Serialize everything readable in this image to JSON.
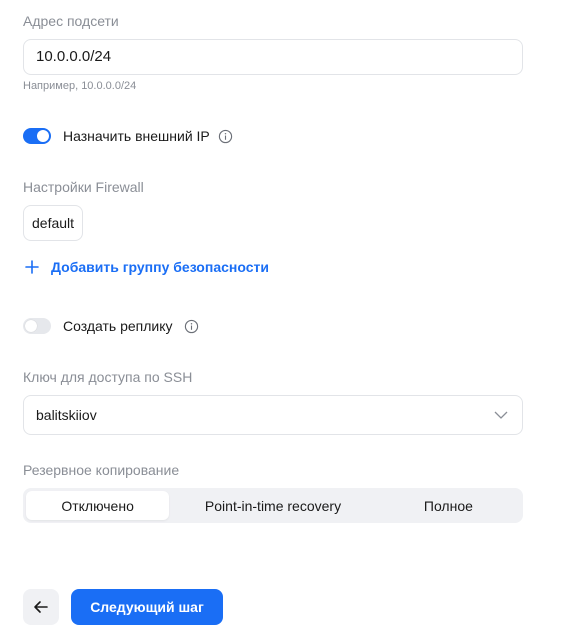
{
  "subnet": {
    "label": "Адрес подсети",
    "value": "10.0.0.0/24",
    "hint": "Например, 10.0.0.0/24"
  },
  "external_ip": {
    "label": "Назначить внешний IP",
    "enabled": true,
    "icon": "info-icon"
  },
  "firewall": {
    "label": "Настройки Firewall",
    "groups": [
      "default"
    ],
    "add_label": "Добавить группу безопасности"
  },
  "replica": {
    "label": "Создать реплику",
    "enabled": false,
    "icon": "info-icon"
  },
  "ssh_key": {
    "label": "Ключ для доступа по SSH",
    "value": "balitskiiov"
  },
  "backup": {
    "label": "Резервное копирование",
    "options": [
      "Отключено",
      "Point-in-time recovery",
      "Полное"
    ],
    "selected": "Отключено"
  },
  "footer": {
    "back_icon": "arrow-left-icon",
    "next_label": "Следующий шаг"
  },
  "colors": {
    "accent": "#1a6ef5",
    "muted_text": "#8a8e96",
    "border": "#e2e4e8",
    "segment_bg": "#f0f1f4"
  }
}
